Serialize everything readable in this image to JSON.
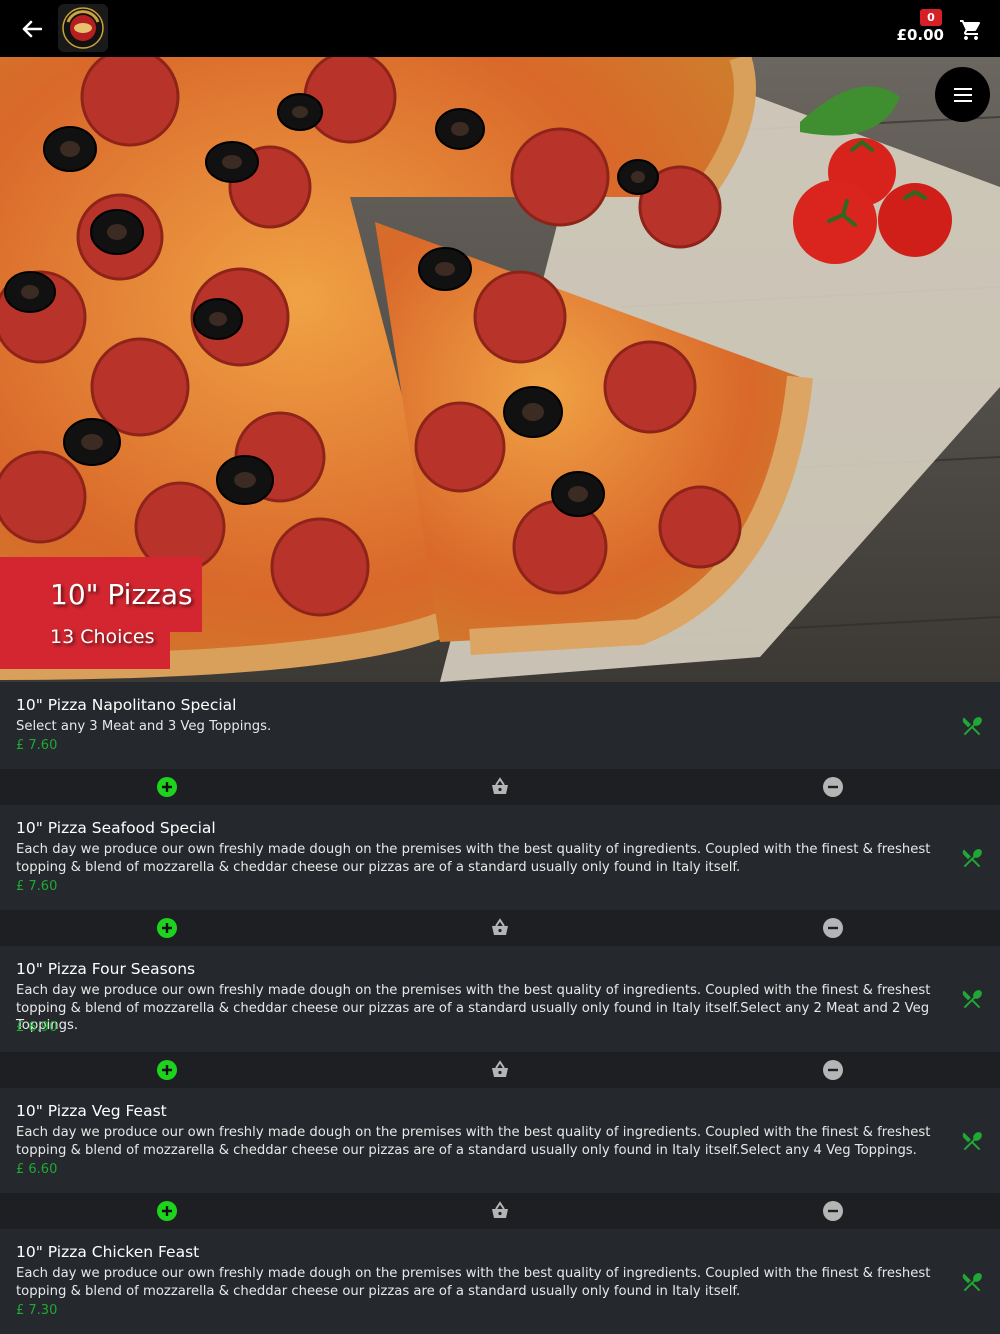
{
  "cart": {
    "total": "£0.00",
    "count": "0"
  },
  "category": {
    "title": "10\" Pizzas",
    "choices": "13 Choices"
  },
  "items": [
    {
      "name": "10\" Pizza Napolitano Special",
      "description": "Select any 3 Meat and 3 Veg Toppings.",
      "price": "£ 7.60"
    },
    {
      "name": "10\" Pizza Seafood Special",
      "description": "Each day we produce our own freshly made dough on the premises with the best quality of ingredients. Coupled with the finest & freshest topping & blend of mozzarella & cheddar cheese our pizzas are of a standard usually only found in Italy itself.",
      "price": "£ 7.60"
    },
    {
      "name": "10\" Pizza Four Seasons",
      "description": "Each day we produce our own freshly made dough on the premises with the best quality of ingredients. Coupled with the finest & freshest topping & blend of mozzarella & cheddar cheese our pizzas are of a standard usually only found in Italy itself.Select any 2 Meat and 2 Veg Toppings.",
      "price": "£ 6.90"
    },
    {
      "name": "10\" Pizza Veg Feast",
      "description": "Each day we produce our own freshly made dough on the premises with the best quality of ingredients. Coupled with the finest & freshest topping & blend of mozzarella & cheddar cheese our pizzas are of a standard usually only found in Italy itself.Select any 4 Veg Toppings.",
      "price": "£ 6.60"
    },
    {
      "name": "10\" Pizza Chicken Feast",
      "description": "Each day we produce our own freshly made dough on the premises with the best quality of ingredients. Coupled with the finest & freshest topping & blend of mozzarella & cheddar cheese our pizzas are of a standard usually only found in Italy itself.",
      "price": "£ 7.30"
    }
  ],
  "colors": {
    "accent": "#d32630",
    "price": "#1fa835",
    "add": "#1ed31e",
    "background": "#25282d"
  },
  "icons": [
    "back-arrow-icon",
    "shopping-cart-icon",
    "hamburger-menu-icon",
    "fork-spoon-icon",
    "plus-circle-icon",
    "basket-icon",
    "minus-circle-icon"
  ]
}
